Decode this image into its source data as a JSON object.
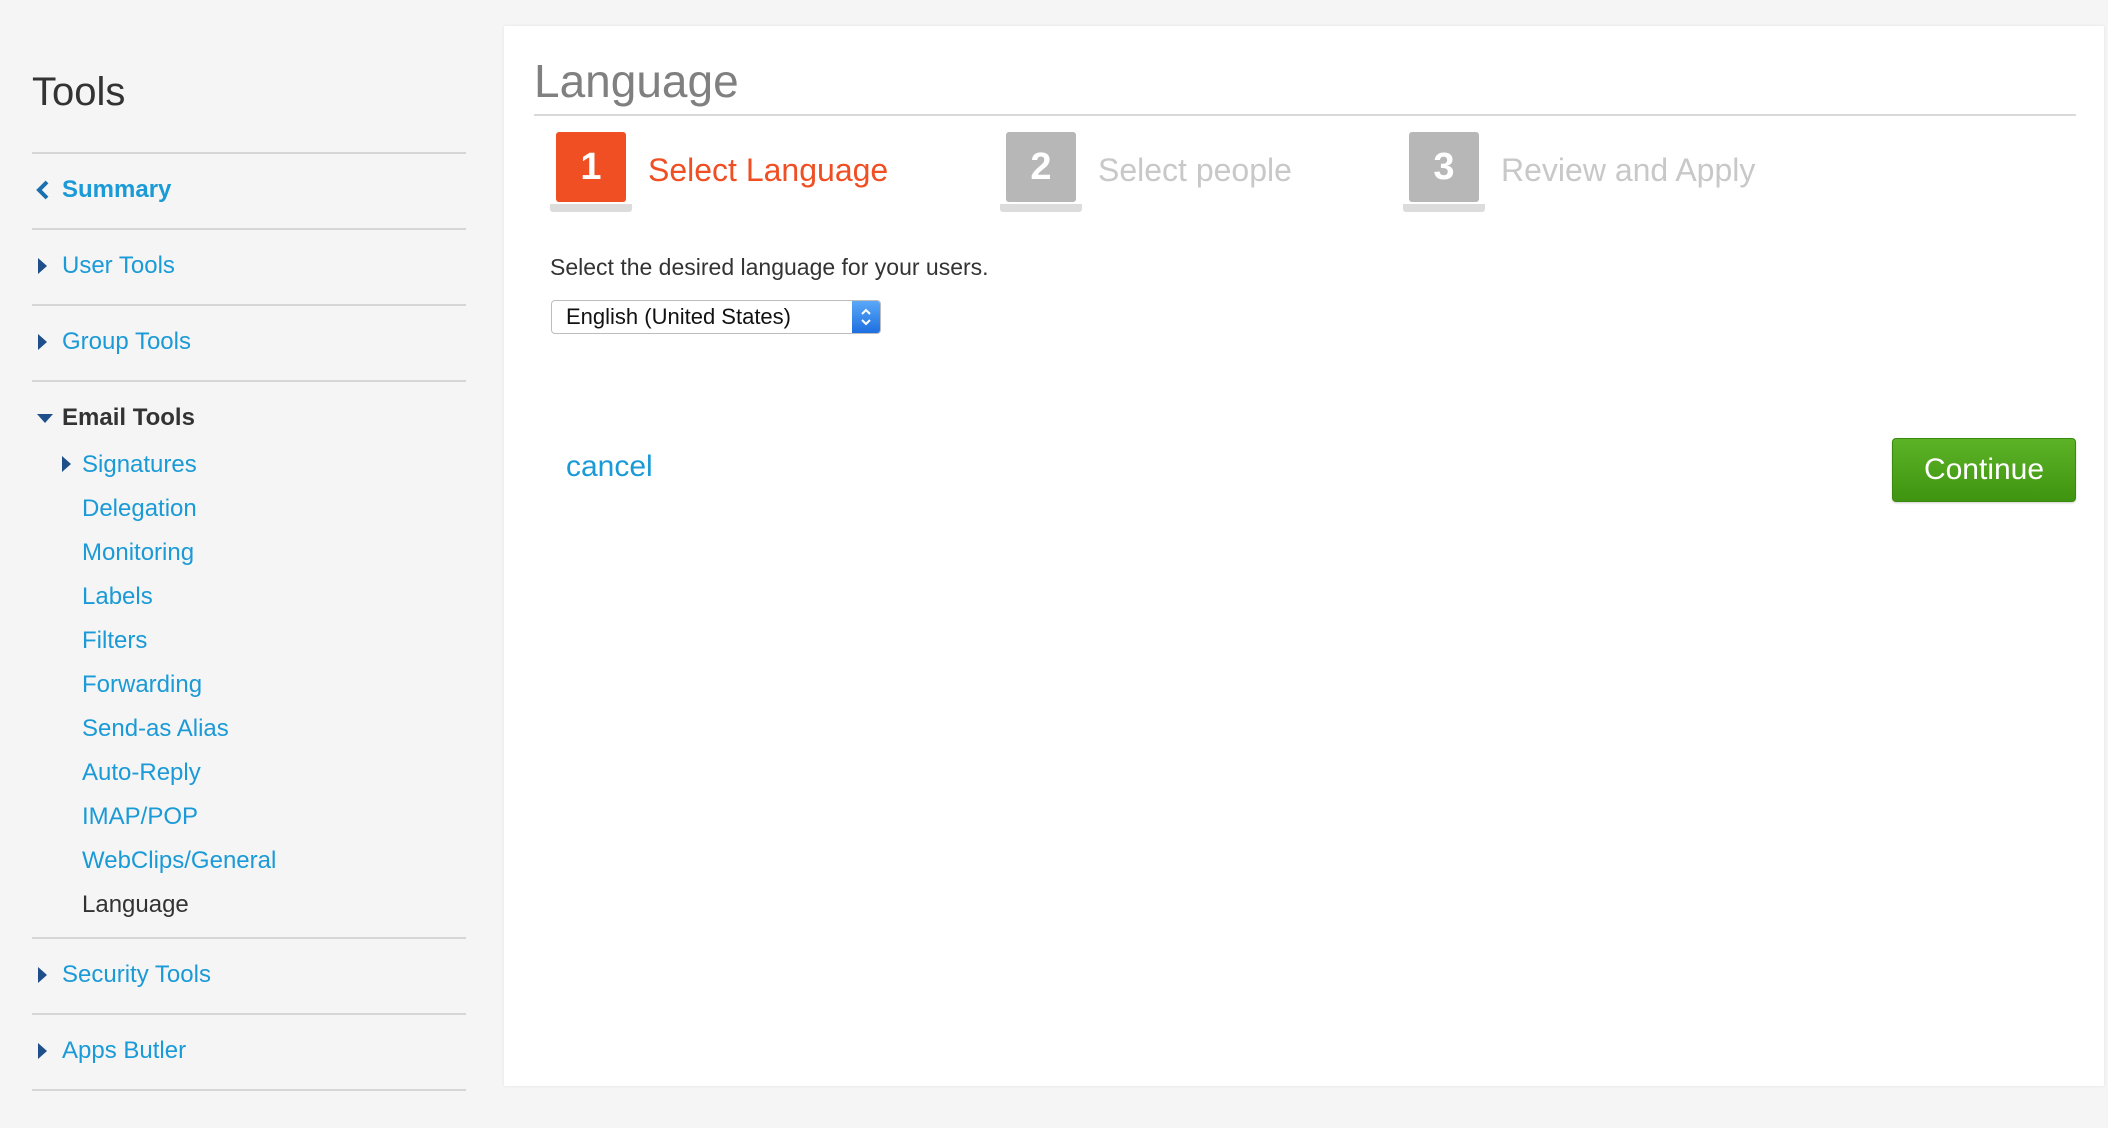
{
  "sidebar": {
    "title": "Tools",
    "items": [
      {
        "label": "Summary",
        "icon": "chevron-left-icon"
      },
      {
        "label": "User Tools",
        "icon": "caret-right-icon"
      },
      {
        "label": "Group Tools",
        "icon": "caret-right-icon"
      },
      {
        "label": "Email Tools",
        "icon": "caret-down-icon"
      },
      {
        "label": "Security Tools",
        "icon": "caret-right-icon"
      },
      {
        "label": "Apps Butler",
        "icon": "caret-right-icon"
      }
    ],
    "email_subitems": [
      {
        "label": "Signatures"
      },
      {
        "label": "Delegation"
      },
      {
        "label": "Monitoring"
      },
      {
        "label": "Labels"
      },
      {
        "label": "Filters"
      },
      {
        "label": "Forwarding"
      },
      {
        "label": "Send-as Alias"
      },
      {
        "label": "Auto-Reply"
      },
      {
        "label": "IMAP/POP"
      },
      {
        "label": "WebClips/General"
      },
      {
        "label": "Language",
        "current": true
      }
    ]
  },
  "main": {
    "title": "Language",
    "steps": [
      {
        "number": "1",
        "label": "Select Language",
        "state": "active"
      },
      {
        "number": "2",
        "label": "Select people",
        "state": "inactive"
      },
      {
        "number": "3",
        "label": "Review and Apply",
        "state": "inactive"
      }
    ],
    "instruction": "Select the desired language for your users.",
    "language_select": {
      "value": "English (United States)"
    },
    "cancel_label": "cancel",
    "continue_label": "Continue"
  },
  "colors": {
    "link": "#1a9ad6",
    "active_step": "#f04e23",
    "inactive_step": "#b7b7b7",
    "continue": "#4ca31a"
  }
}
